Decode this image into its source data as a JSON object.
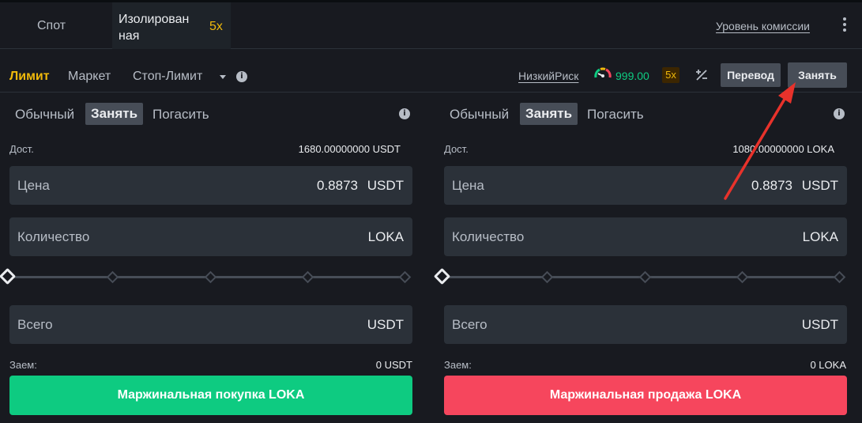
{
  "top_tabs": {
    "spot": "Спот",
    "isolated": "Изолирован ная",
    "isolated_leverage": "5x"
  },
  "fee_level_link": "Уровень комиссии",
  "order_types": {
    "limit": "Лимит",
    "market": "Маркет",
    "stop_limit": "Стоп-Лимит"
  },
  "risk": {
    "label": "НизкийРиск",
    "value": "999.00",
    "leverage": "5x"
  },
  "buttons": {
    "transfer": "Перевод",
    "borrow": "Занять"
  },
  "colors": {
    "accent": "#f0b90b",
    "buy": "#0ecb81",
    "sell": "#f6465d",
    "background": "#181a20",
    "field": "#2b3139"
  },
  "left_panel": {
    "modes": {
      "normal": "Обычный",
      "borrow": "Занять",
      "repay": "Погасить"
    },
    "available_label": "Дост.",
    "available_value": "1680.00000000 USDT",
    "price": {
      "placeholder": "Цена",
      "value": "0.8873",
      "unit": "USDT"
    },
    "amount": {
      "placeholder": "Количество",
      "unit": "LOKA"
    },
    "slider_percent": 0,
    "total": {
      "placeholder": "Всего",
      "unit": "USDT"
    },
    "loan_label": "Заем:",
    "loan_value": "0 USDT",
    "action": "Маржинальная покупка LOKA"
  },
  "right_panel": {
    "modes": {
      "normal": "Обычный",
      "borrow": "Занять",
      "repay": "Погасить"
    },
    "available_label": "Дост.",
    "available_value": "1080.00000000 LOKA",
    "price": {
      "placeholder": "Цена",
      "value": "0.8873",
      "unit": "USDT"
    },
    "amount": {
      "placeholder": "Количество",
      "unit": "LOKA"
    },
    "slider_percent": 0,
    "total": {
      "placeholder": "Всего",
      "unit": "USDT"
    },
    "loan_label": "Заем:",
    "loan_value": "0 LOKA",
    "action": "Маржинальная продажа LOKA"
  }
}
